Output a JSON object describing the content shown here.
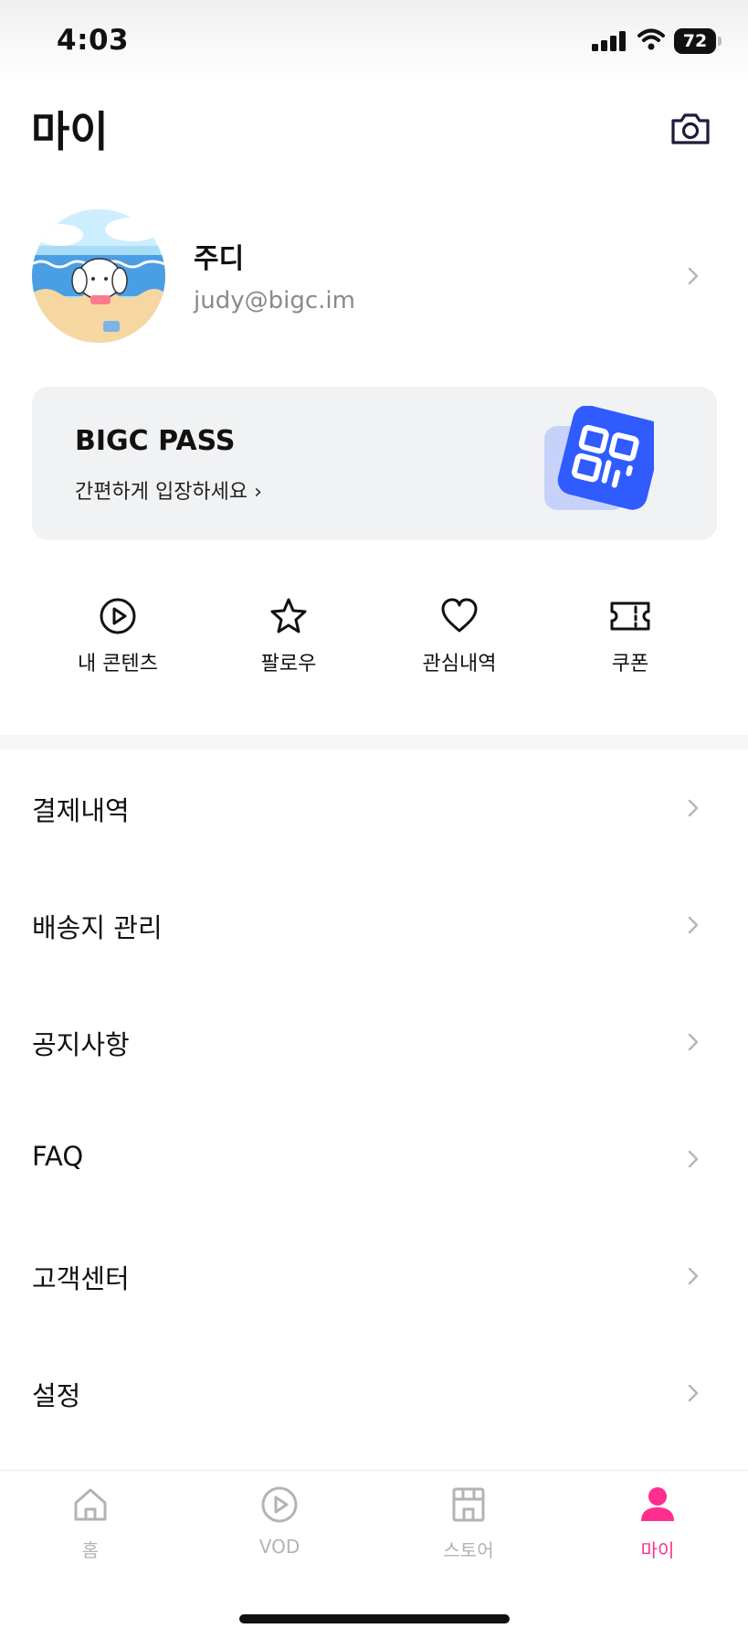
{
  "status_bar": {
    "time": "4:03",
    "battery": "72"
  },
  "header": {
    "title": "마이",
    "camera_icon": "camera-icon"
  },
  "profile": {
    "name": "주디",
    "email": "judy@bigc.im"
  },
  "pass_card": {
    "title": "BIGC PASS",
    "subtitle": "간편하게 입장하세요 ›"
  },
  "quick_menu": [
    {
      "label": "내 콘텐츠",
      "icon": "play-circle-icon"
    },
    {
      "label": "팔로우",
      "icon": "star-icon"
    },
    {
      "label": "관심내역",
      "icon": "heart-icon"
    },
    {
      "label": "쿠폰",
      "icon": "ticket-icon"
    }
  ],
  "menu_list": [
    {
      "label": "결제내역"
    },
    {
      "label": "배송지 관리"
    },
    {
      "label": "공지사항"
    },
    {
      "label": "FAQ"
    },
    {
      "label": "고객센터"
    },
    {
      "label": "설정"
    }
  ],
  "bottom_nav": [
    {
      "label": "홈",
      "icon": "home-icon",
      "active": false
    },
    {
      "label": "VOD",
      "icon": "play-circle-icon",
      "active": false
    },
    {
      "label": "스토어",
      "icon": "store-icon",
      "active": false
    },
    {
      "label": "마이",
      "icon": "person-icon",
      "active": true
    }
  ],
  "colors": {
    "accent": "#ff2d8f",
    "pass_blue": "#2f5bff",
    "card_bg": "#f1f2f4",
    "inactive": "#b3b3b3"
  }
}
